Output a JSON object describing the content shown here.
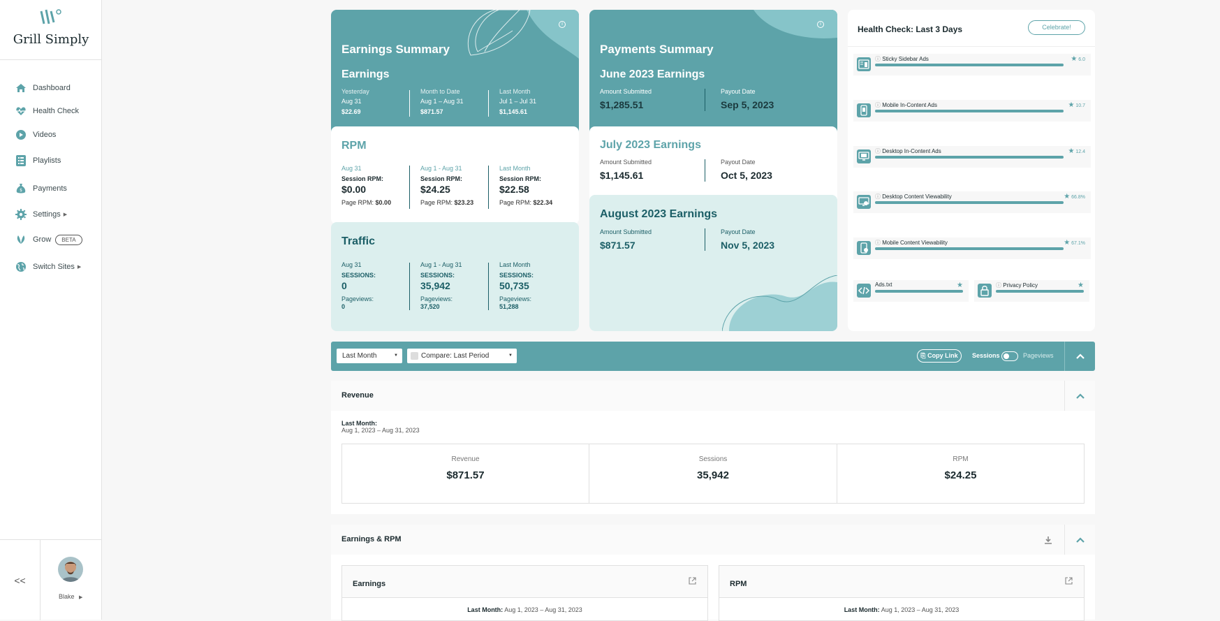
{
  "sidebar": {
    "logo_text": "Grill Simply",
    "items": [
      {
        "label": "Dashboard"
      },
      {
        "label": "Health Check"
      },
      {
        "label": "Videos"
      },
      {
        "label": "Playlists"
      },
      {
        "label": "Payments"
      },
      {
        "label": "Settings"
      },
      {
        "label": "Grow",
        "badge": "BETA"
      },
      {
        "label": "Switch Sites"
      }
    ],
    "collapse_label": "<<",
    "user_name": "Blake"
  },
  "earnings_summary": {
    "title": "Earnings Summary",
    "earnings": {
      "heading": "Earnings",
      "cols": [
        {
          "label": "Yesterday",
          "date": "Aug 31",
          "value": "$22.69"
        },
        {
          "label": "Month to Date",
          "date": "Aug 1 – Aug 31",
          "value": "$871.57"
        },
        {
          "label": "Last Month",
          "date": "Jul 1 – Jul 31",
          "value": "$1,145.61"
        }
      ]
    },
    "rpm": {
      "heading": "RPM",
      "session_label": "Session RPM:",
      "page_label": "Page RPM:",
      "cols": [
        {
          "label": "Aug 31",
          "session": "$0.00",
          "page": "$0.00"
        },
        {
          "label": "Aug 1 - Aug 31",
          "session": "$24.25",
          "page": "$23.23"
        },
        {
          "label": "Last Month",
          "session": "$22.58",
          "page": "$22.34"
        }
      ]
    },
    "traffic": {
      "heading": "Traffic",
      "sessions_label": "SESSIONS:",
      "pageviews_label": "Pageviews:",
      "cols": [
        {
          "label": "Aug 31",
          "sessions": "0",
          "pageviews": "0"
        },
        {
          "label": "Aug 1 - Aug 31",
          "sessions": "35,942",
          "pageviews": "37,520"
        },
        {
          "label": "Last Month",
          "sessions": "50,735",
          "pageviews": "51,288"
        }
      ]
    }
  },
  "payments_summary": {
    "title": "Payments Summary",
    "amount_label": "Amount Submitted",
    "payout_label": "Payout Date",
    "months": [
      {
        "heading": "June 2023 Earnings",
        "amount": "$1,285.51",
        "payout": "Sep 5, 2023"
      },
      {
        "heading": "July 2023 Earnings",
        "amount": "$1,145.61",
        "payout": "Oct 5, 2023"
      },
      {
        "heading": "August 2023 Earnings",
        "amount": "$871.57",
        "payout": "Nov 5, 2023"
      }
    ]
  },
  "health_check": {
    "title": "Health Check: Last 3 Days",
    "celebrate_label": "Celebrate!",
    "items": [
      {
        "name": "Sticky Sidebar Ads",
        "score": "6.0",
        "fill": 1.0
      },
      {
        "name": "Mobile In-Content Ads",
        "score": "10.7",
        "fill": 1.0
      },
      {
        "name": "Desktop In-Content Ads",
        "score": "12.4",
        "fill": 1.0
      },
      {
        "name": "Desktop Content Viewability",
        "score": "66.8%",
        "fill": 1.0
      },
      {
        "name": "Mobile Content Viewability",
        "score": "67.1%",
        "fill": 1.0
      }
    ],
    "small_items": [
      {
        "name": "Ads.txt"
      },
      {
        "name": "Privacy Policy"
      }
    ]
  },
  "filters": {
    "period": "Last Month",
    "compare": "Compare: Last Period",
    "copy_link": "Copy Link",
    "toggle_left": "Sessions",
    "toggle_right": "Pageviews"
  },
  "revenue": {
    "title": "Revenue",
    "period_label": "Last Month:",
    "period_range": "Aug 1, 2023 – Aug 31, 2023",
    "stats": [
      {
        "label": "Revenue",
        "value": "$871.57"
      },
      {
        "label": "Sessions",
        "value": "35,942"
      },
      {
        "label": "RPM",
        "value": "$24.25"
      }
    ]
  },
  "earnings_rpm": {
    "title": "Earnings & RPM",
    "subpanels": [
      {
        "title": "Earnings",
        "range_label": "Last Month:",
        "range": "Aug 1, 2023 – Aug 31, 2023"
      },
      {
        "title": "RPM",
        "range_label": "Last Month:",
        "range": "Aug 1, 2023 – Aug 31, 2023"
      }
    ]
  },
  "colors": {
    "accent": "#5da3a9",
    "light": "#dcefee",
    "dark": "#1b5e66"
  }
}
